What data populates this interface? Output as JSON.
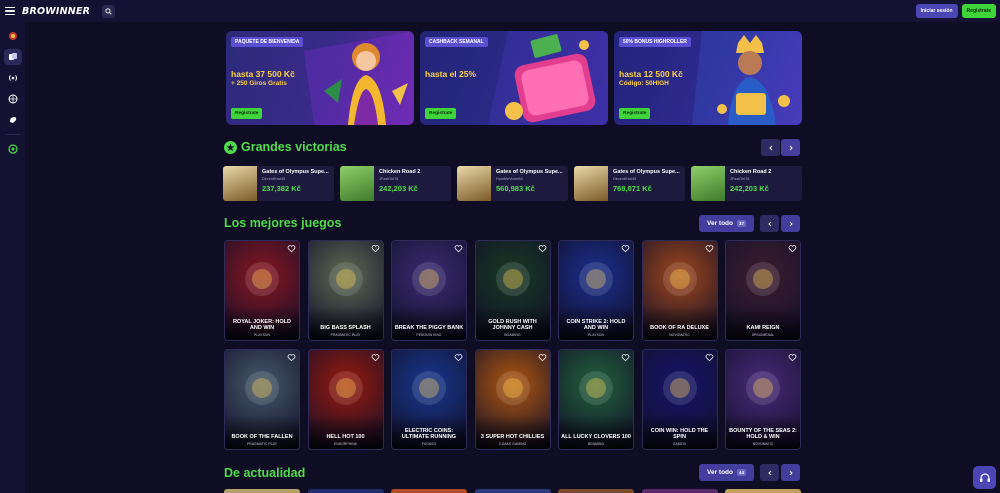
{
  "header": {
    "logo": "BROWINNER",
    "login_label": "Iniciar sesión",
    "register_label": "Registrate"
  },
  "sidebar": {
    "items": [
      "brand-icon",
      "casino-icon",
      "live-icon",
      "sports-icon",
      "virtual-icon",
      "help-icon"
    ]
  },
  "promos": [
    {
      "tag": "PAQUETE DE BIENVENIDA",
      "line1": "hasta 37 500 Kč",
      "line2": "+ 250 Giros Gratis",
      "button": "Registrate",
      "color": "#3b2a8a"
    },
    {
      "tag": "CASHBACK SEMANAL",
      "line1": "hasta el 25%",
      "line2": "",
      "button": "Registrate",
      "color": "#2a2a86"
    },
    {
      "tag": "50% BONUS HIGHROLLER",
      "line1": "hasta 12 500 Kč",
      "line2": "Código: 50HIGH",
      "button": "Registrate",
      "color": "#2e2a90"
    }
  ],
  "big_wins": {
    "title": "Grandes victorias",
    "items": [
      {
        "game": "Gates of Olympus Supe...",
        "user": "DecentKiwi45",
        "amount": "237,382 Kč"
      },
      {
        "game": "Chicken Road 2",
        "user": "JFastGirl76",
        "amount": "242,203 Kč"
      },
      {
        "game": "Gates of Olympus Supe...",
        "user": "HumbleViolet84",
        "amount": "560,983 Kč"
      },
      {
        "game": "Gates of Olympus Supe...",
        "user": "DecentKiwi45",
        "amount": "769,071 Kč"
      },
      {
        "game": "Chicken Road 2",
        "user": "JFastGirl76",
        "amount": "242,203 Kč"
      }
    ]
  },
  "best_games": {
    "title": "Los mejores juegos",
    "view_all": "Ver todo",
    "count": "37",
    "items": [
      {
        "title": "ROYAL JOKER: HOLD AND WIN",
        "provider": "PLAYSON",
        "color": "#8a1620"
      },
      {
        "title": "BIG BASS SPLASH",
        "provider": "PRAGMATIC PLAY",
        "color": "#5c6b52"
      },
      {
        "title": "BREAK THE PIGGY BANK",
        "provider": "PENGUIN KING",
        "color": "#3a2c73"
      },
      {
        "title": "GOLD RUSH WITH JOHNNY CASH",
        "provider": "BGAMING",
        "color": "#173a22"
      },
      {
        "title": "COIN STRIKE 2: HOLD AND WIN",
        "provider": "PLAYSON",
        "color": "#1a2f8e"
      },
      {
        "title": "BOOK OF RA DELUXE",
        "provider": "NOVOMATIC",
        "color": "#a0471b"
      },
      {
        "title": "KAMI REIGN",
        "provider": "SPINOMENAL",
        "color": "#3e1e30"
      },
      {
        "title": "BOOK OF THE FALLEN",
        "provider": "PRAGMATIC PLAY",
        "color": "#465a6a"
      },
      {
        "title": "HELL HOT 100",
        "provider": "ENDORPHINA",
        "color": "#9a1a0c"
      },
      {
        "title": "ELECTRIC COINS: ULTIMATE RUNNING",
        "provider": "FUGASO",
        "color": "#17388f"
      },
      {
        "title": "3 SUPER HOT CHILLIES",
        "provider": "3 OAKS GAMING",
        "color": "#b0580e"
      },
      {
        "title": "ALL LUCKY CLOVERS 100",
        "provider": "BGAMING",
        "color": "#21613a"
      },
      {
        "title": "COIN WIN: HOLD THE SPIN",
        "provider": "GAMZIX",
        "color": "#14146a"
      },
      {
        "title": "BOUNTY OF THE SEAS 2: HOLD & WIN",
        "provider": "NOVOMATIC",
        "color": "#4a2a7a"
      }
    ]
  },
  "trending": {
    "title": "De actualidad",
    "view_all": "Ver todo",
    "count": "44"
  },
  "support_icon": "headset-icon"
}
